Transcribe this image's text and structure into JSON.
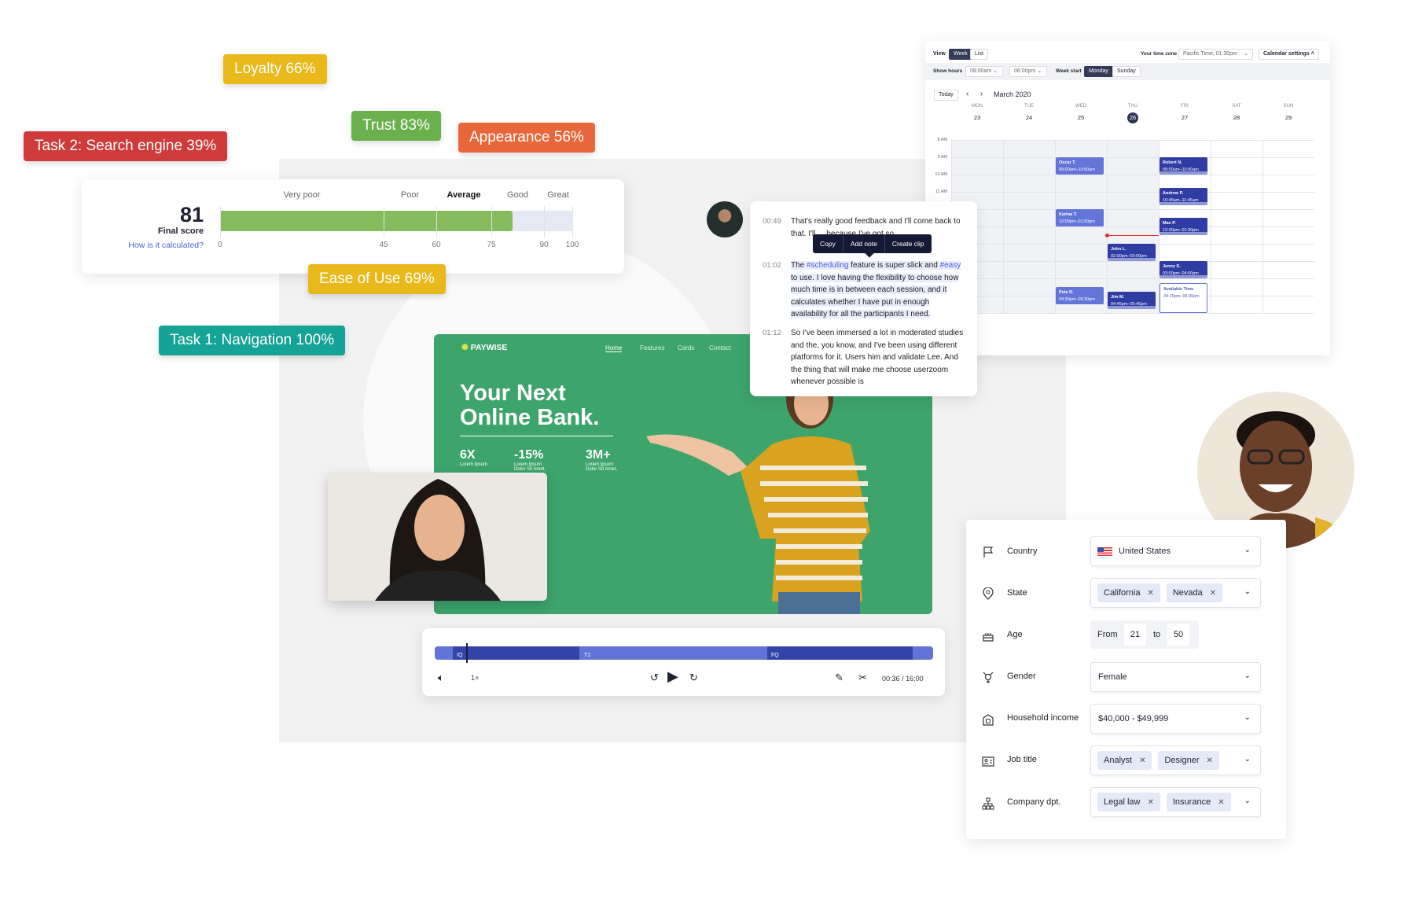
{
  "badges": [
    {
      "label": "Loyalty 66%",
      "color": "#e9b81a"
    },
    {
      "label": "Task 2: Search engine 39%",
      "color": "#cf3b3b"
    },
    {
      "label": "Trust 83%",
      "color": "#6ab04c"
    },
    {
      "label": "Appearance 56%",
      "color": "#e8673a"
    },
    {
      "label": "Ease of Use 69%",
      "color": "#e9b81a"
    },
    {
      "label": "Task 1: Navigation 100%",
      "color": "#14a394"
    }
  ],
  "score": {
    "value": 81,
    "value_label": "81",
    "label": "Final score",
    "link": "How is it calculated?",
    "bands": [
      "Very poor",
      "Poor",
      "Average",
      "Good",
      "Great"
    ],
    "active_band": "Average",
    "ticks": [
      "0",
      "45",
      "60",
      "75",
      "90",
      "100"
    ],
    "fill_color": "#86bc5e",
    "track_color": "#e6e8f3"
  },
  "website": {
    "brand": "PAYWISE",
    "nav": [
      "Home",
      "Features",
      "Cards",
      "Contact"
    ],
    "active_nav": "Home",
    "headline1": "Your Next",
    "headline2": "Online Bank.",
    "stats": [
      {
        "value": "6X",
        "caption": "Lorem Ipsum"
      },
      {
        "value": "-15%",
        "caption": "Lorem Ipsum Dolor Sit Amet,"
      },
      {
        "value": "3M+",
        "caption": "Lorem Ipsum Dolor Sit Amet,"
      }
    ],
    "bg_color": "#3da46b"
  },
  "transcript": {
    "entries": [
      {
        "time": "00:49",
        "text": "That's really good feedback and I'll come back to that. I'll ... because I've got so"
      },
      {
        "time": "01:02",
        "pre": "The ",
        "tag1": "#scheduling",
        "mid": " feature is super slick and ",
        "tag2": "#easy",
        "post": " to use. I love having the flexibility to choose how much time is in between each session, and it calculates whether I have put in enough availability for all the participants I need."
      },
      {
        "time": "01:12",
        "text": "So I've been immersed a lot in moderated studies and the, you know, and I've been using different platforms for it. Users him and validate Lee. And the thing that will make me choose userzoom whenever possible is"
      }
    ],
    "menu": [
      "Copy",
      "Add note",
      "Create clip"
    ]
  },
  "calendar": {
    "view_label": "View",
    "views": [
      "Week",
      "List"
    ],
    "active_view": "Week",
    "timezone_label": "Your time zone",
    "timezone": "Pacific Time, 01:30pm",
    "settings": "Calendar settings",
    "show_hours_label": "Show hours",
    "hours_from": "08:00am",
    "hours_to": "06:00pm",
    "week_start_label": "Week start",
    "week_starts": [
      "Monday",
      "Sunday"
    ],
    "active_week_start": "Monday",
    "today": "Today",
    "month": "March 2020",
    "days": [
      {
        "name": "MON",
        "date": "23"
      },
      {
        "name": "TUE",
        "date": "24"
      },
      {
        "name": "WED",
        "date": "25"
      },
      {
        "name": "THU",
        "date": "26",
        "today": true
      },
      {
        "name": "FRI",
        "date": "27"
      },
      {
        "name": "SAT",
        "date": "28"
      },
      {
        "name": "SUN",
        "date": "29"
      }
    ],
    "hour_labels": [
      "8 AM",
      "9 AM",
      "10 AM",
      "11 AM"
    ],
    "now": "13:30",
    "events": [
      {
        "name": "Oscar T.",
        "time": "09:00am–10:00am",
        "day": 2,
        "start": 9,
        "end": 10,
        "style": "light"
      },
      {
        "name": "Karina T.",
        "time": "12:00pm–01:00pm",
        "day": 2,
        "start": 12,
        "end": 13,
        "style": "light"
      },
      {
        "name": "Pete D.",
        "time": "04:30pm–05:30pm",
        "day": 2,
        "start": 16.5,
        "end": 17.5,
        "style": "light"
      },
      {
        "name": "John L.",
        "time": "02:00pm–03:00pm",
        "day": 3,
        "start": 14,
        "end": 15,
        "style": "dark"
      },
      {
        "name": "Jim M.",
        "time": "04:45pm–05:45pm",
        "day": 3,
        "start": 16.75,
        "end": 17.75,
        "style": "dark"
      },
      {
        "name": "Robert N.",
        "time": "09:00am–10:00am",
        "day": 4,
        "start": 9,
        "end": 10,
        "style": "dark"
      },
      {
        "name": "Andrew P.",
        "time": "10:45am–11:45am",
        "day": 4,
        "start": 10.75,
        "end": 11.75,
        "style": "dark"
      },
      {
        "name": "Max P.",
        "time": "12:30pm–01:30pm",
        "day": 4,
        "start": 12.5,
        "end": 13.5,
        "style": "dark"
      },
      {
        "name": "Jenny S.",
        "time": "03:00pm–04:00pm",
        "day": 4,
        "start": 15,
        "end": 16,
        "style": "dark"
      },
      {
        "name": "Available Time",
        "time": "04:15pm–06:00pm",
        "day": 4,
        "start": 16.25,
        "end": 18,
        "style": "available"
      }
    ]
  },
  "form": {
    "country": {
      "label": "Country",
      "value": "United States",
      "icon": "flag-icon"
    },
    "state": {
      "label": "State",
      "chips": [
        "California",
        "Nevada"
      ],
      "icon": "location-pin-icon"
    },
    "age": {
      "label": "Age",
      "from_label": "From",
      "from": "21",
      "to_label": "to",
      "to": "50",
      "icon": "cake-icon"
    },
    "gender": {
      "label": "Gender",
      "value": "Female",
      "icon": "gender-icon"
    },
    "income": {
      "label": "Household income",
      "value": "$40,000 - $49,999",
      "icon": "house-money-icon"
    },
    "job": {
      "label": "Job title",
      "chips": [
        "Analyst",
        "Designer"
      ],
      "icon": "id-card-icon"
    },
    "dept": {
      "label": "Company dpt.",
      "chips": [
        "Legal law",
        "Insurance"
      ],
      "icon": "org-chart-icon"
    }
  },
  "player": {
    "segments": [
      "IQ",
      "T1",
      "FQ"
    ],
    "speed": "1×",
    "current": "00:36",
    "total": "16:00",
    "time_sep": "/",
    "progress": 0.0375
  }
}
